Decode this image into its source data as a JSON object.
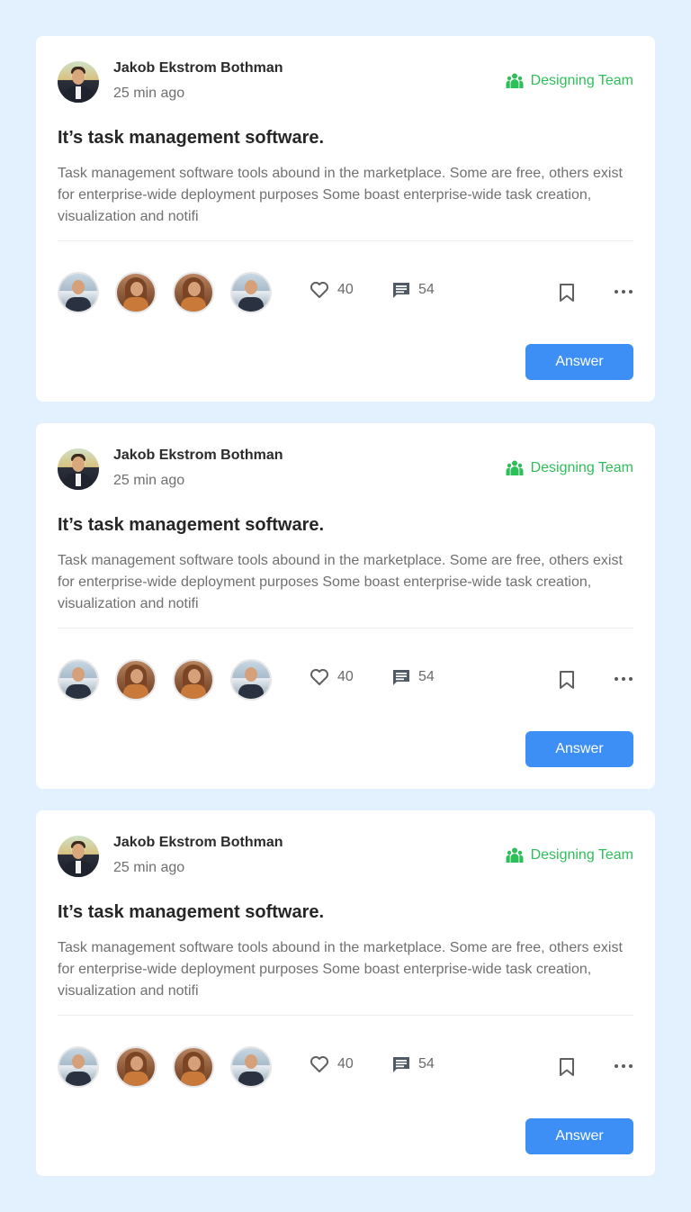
{
  "colors": {
    "background": "#e3f1fe",
    "card": "#ffffff",
    "team_accent": "#2fbf5a",
    "button": "#3d8ff5"
  },
  "posts": [
    {
      "author_name": "Jakob Ekstrom Bothman",
      "time": "25 min ago",
      "team": "Designing Team",
      "team_icon": "team-icon",
      "title": "It’s task management software.",
      "body": "Task management software tools abound in the marketplace. Some are free, others exist for enterprise-wide deployment purposes Some boast enterprise-wide task creation, visualization and notifi",
      "likes": "40",
      "comments": "54",
      "answer_label": "Answer"
    },
    {
      "author_name": "Jakob Ekstrom Bothman",
      "time": "25 min ago",
      "team": "Designing Team",
      "team_icon": "team-icon",
      "title": "It’s task management software.",
      "body": "Task management software tools abound in the marketplace. Some are free, others exist for enterprise-wide deployment purposes Some boast enterprise-wide task creation, visualization and notifi",
      "likes": "40",
      "comments": "54",
      "answer_label": "Answer"
    },
    {
      "author_name": "Jakob Ekstrom Bothman",
      "time": "25 min ago",
      "team": "Designing Team",
      "team_icon": "team-icon",
      "title": "It’s task management software.",
      "body": "Task management software tools abound in the marketplace. Some are free, others exist for enterprise-wide deployment purposes Some boast enterprise-wide task creation, visualization and notifi",
      "likes": "40",
      "comments": "54",
      "answer_label": "Answer"
    }
  ]
}
